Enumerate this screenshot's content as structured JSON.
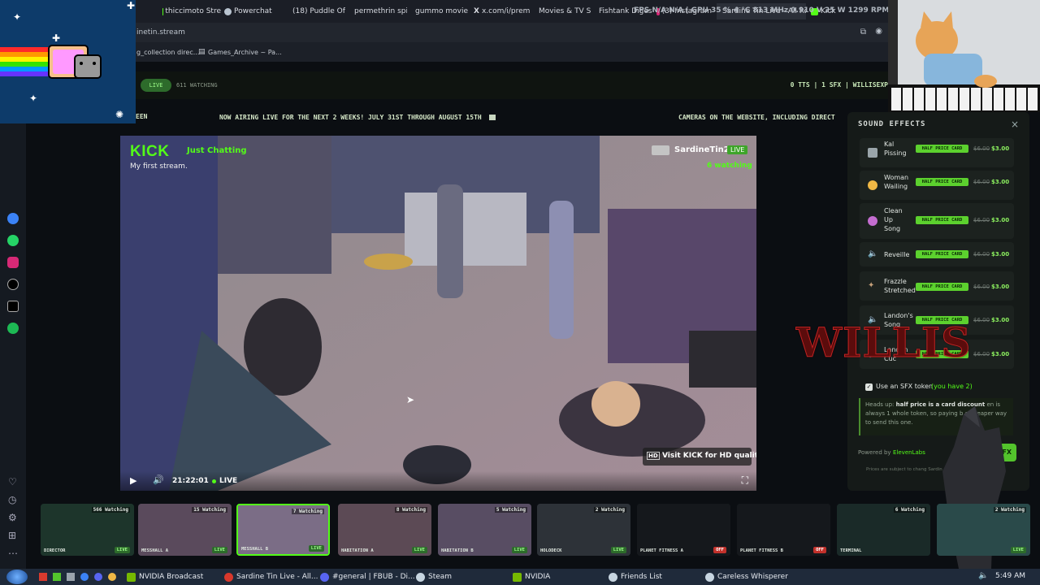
{
  "browser": {
    "tabs": [
      {
        "label": "thiccimoto Stre",
        "color": "#53fc18"
      },
      {
        "label": "Powerchat",
        "color": "#b9c4d0"
      },
      {
        "label": "(18) Puddle Of I",
        "color": "#ff3b30"
      },
      {
        "label": "permethrin spic",
        "color": "#c9cdd3"
      },
      {
        "label": "gummo movie",
        "color": "#c9cdd3"
      },
      {
        "label": "x.com/i/premiu",
        "color": "#ffffff"
      },
      {
        "label": "Movies & TV Sh",
        "color": "#9aa3ad"
      },
      {
        "label": "Fishtank Diges",
        "color": "#e0412f"
      },
      {
        "label": "(3) Instagram",
        "color": "#d62976"
      },
      {
        "label": "Sardine Tin Live - All Ro",
        "color": "#b0b6bf"
      },
      {
        "label": "Kick",
        "color": "#53fc18"
      }
    ],
    "overlay_stats": "FPS N/A N/A | GPU 35 % 4 °C 813 MHz 0.910 V 25 W 1299 RPM",
    "address": "inetin.stream",
    "bookmarks": [
      "g_collection direc...",
      "Games_Archive ~ Pa..."
    ]
  },
  "site": {
    "live_label": "LIVE",
    "watching": "611 WATCHING",
    "right_status": "0 TTS | 1 SFX | WILLISEXP",
    "left_fragment": "EEN",
    "ticker_left": "NOW AIRING LIVE FOR THE NEXT 2 WEEKS! JULY 31ST THROUGH AUGUST 15TH",
    "ticker_right": "CAMERAS ON THE WEBSITE, INCLUDING DIRECT"
  },
  "player": {
    "platform": "KICK",
    "category": "Just Chatting",
    "stream_title": "My first stream.",
    "channel": "SardineTin2",
    "live_badge": "LIVE",
    "viewers": "6 watching",
    "time": "21:22:01",
    "live_status": "LIVE",
    "hd_prompt": "Visit KICK for HD quality",
    "hd_badge": "HD"
  },
  "sfx_panel": {
    "title": "SOUND EFFECTS",
    "items": [
      {
        "name": "Kal\nPissing",
        "badge": "HALF PRICE CARD",
        "old_price": "$6.00",
        "price": "$3.00"
      },
      {
        "name": "Woman\nWailing",
        "badge": "HALF PRICE CARD",
        "old_price": "$6.00",
        "price": "$3.00"
      },
      {
        "name": "Clean\nUp\nSong",
        "badge": "HALF PRICE CARD",
        "old_price": "$6.00",
        "price": "$3.00"
      },
      {
        "name": "Reveille",
        "badge": "HALF PRICE CARD",
        "old_price": "$6.00",
        "price": "$3.00"
      },
      {
        "name": "Frazzle\nStretched",
        "badge": "HALF PRICE CARD",
        "old_price": "$6.00",
        "price": "$3.00"
      },
      {
        "name": "Landon's\nSong",
        "badge": "HALF PRICE CARD",
        "old_price": "$6.00",
        "price": "$3.00"
      },
      {
        "name": "Landon\nCuc",
        "badge": "HALF PRICE CARD",
        "old_price": "$6.00",
        "price": "$3.00"
      }
    ],
    "token_label": "Use an SFX token",
    "token_count": "(you have 2)",
    "notice_lead": "Heads up:",
    "notice_bold": "half price is a card discount",
    "notice_rest": "en is always 1 whole token, so paying b e cheaper way to send this one.",
    "powered_by": "Powered by",
    "powered_brand": "ElevenLabs",
    "send_label": "FX",
    "fine_print": "Prices are subject to chang  Sardin"
  },
  "overlay_text": "WILLIS",
  "thumbnails": [
    {
      "watching": "566 Watching",
      "label": "DIRECTOR",
      "status": "LIVE",
      "tint": "#1b3a2a"
    },
    {
      "watching": "15 Watching",
      "label": "MESSHALL A",
      "status": "LIVE",
      "tint": "#5a4a5c"
    },
    {
      "watching": "7 Watching",
      "label": "MESSHALL B",
      "status": "LIVE",
      "tint": "#7b6d86"
    },
    {
      "watching": "8 Watching",
      "label": "HABITATION A",
      "status": "LIVE",
      "tint": "#5c4a55"
    },
    {
      "watching": "5 Watching",
      "label": "HABITATION B",
      "status": "LIVE",
      "tint": "#584d63"
    },
    {
      "watching": "2 Watching",
      "label": "HOLODECK",
      "status": "LIVE",
      "tint": "#2d3238"
    },
    {
      "watching": "",
      "label": "PLANET FITNESS A",
      "status": "OFF",
      "tint": "#15181c"
    },
    {
      "watching": "",
      "label": "PLANET FITNESS B",
      "status": "OFF",
      "tint": "#15181c"
    },
    {
      "watching": "6 Watching",
      "label": "TERMINAL",
      "status": "",
      "tint": "#1a2a28"
    },
    {
      "watching": "2 Watching",
      "label": "",
      "status": "LIVE",
      "tint": "#2a4a4a"
    }
  ],
  "taskbar": {
    "items": [
      {
        "label": "NVIDIA Broadcast",
        "color": "#76b900"
      },
      {
        "label": "Sardine Tin Live - All...",
        "color": "#d9382b"
      },
      {
        "label": "#general | FBUB - Di...",
        "color": "#5865f2"
      },
      {
        "label": "Steam",
        "color": "#c7d5e0"
      },
      {
        "label": "NVIDIA",
        "color": "#76b900"
      },
      {
        "label": "Friends List",
        "color": "#c7d5e0"
      },
      {
        "label": "Careless Whisperer",
        "color": "#c7d5e0"
      }
    ],
    "clock": "5:49 AM"
  },
  "colors": {
    "kick_green": "#53fc18",
    "half_price_green": "#5cd12e",
    "thumb_active_border": "#53fc18",
    "off_red": "#c2312b"
  }
}
